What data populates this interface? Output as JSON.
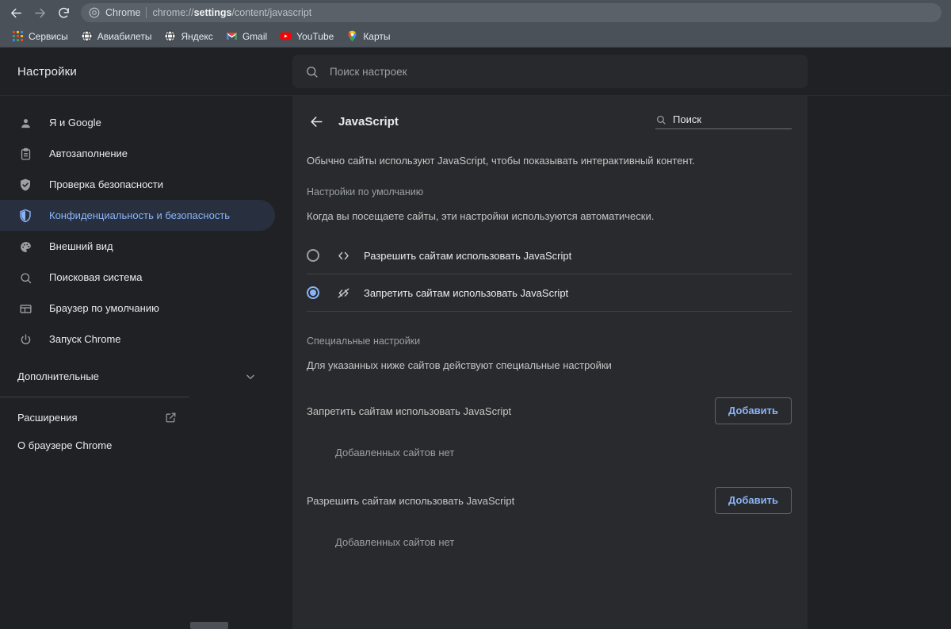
{
  "browser": {
    "nav": {
      "back_icon": "arrow-left-icon",
      "forward_icon": "arrow-right-icon",
      "reload_icon": "reload-icon"
    },
    "omnibox": {
      "site_icon": "chrome-logo-icon",
      "chip_label": "Chrome",
      "url_prefix": "chrome://",
      "url_bold": "settings",
      "url_suffix": "/content/javascript"
    },
    "bookmarks": [
      {
        "label": "Сервисы",
        "icon": "google-apps-grid-icon"
      },
      {
        "label": "Авиабилеты",
        "icon": "globe-icon"
      },
      {
        "label": "Яндекс",
        "icon": "globe-icon"
      },
      {
        "label": "Gmail",
        "icon": "gmail-icon"
      },
      {
        "label": "YouTube",
        "icon": "youtube-icon"
      },
      {
        "label": "Карты",
        "icon": "google-maps-pin-icon"
      }
    ]
  },
  "settings": {
    "brand_title": "Настройки",
    "search": {
      "icon": "search-icon",
      "placeholder": "Поиск настроек",
      "value": ""
    },
    "sidebar": {
      "items": [
        {
          "label": "Я и Google",
          "icon": "person-icon",
          "active": false
        },
        {
          "label": "Автозаполнение",
          "icon": "clipboard-icon",
          "active": false
        },
        {
          "label": "Проверка безопасности",
          "icon": "shield-check-icon",
          "active": false
        },
        {
          "label": "Конфиденциальность и безопасность",
          "icon": "shield-half-icon",
          "active": true
        },
        {
          "label": "Внешний вид",
          "icon": "palette-icon",
          "active": false
        },
        {
          "label": "Поисковая система",
          "icon": "search-icon",
          "active": false
        },
        {
          "label": "Браузер по умолчанию",
          "icon": "browser-window-icon",
          "active": false
        },
        {
          "label": "Запуск Chrome",
          "icon": "power-icon",
          "active": false
        }
      ],
      "advanced_label": "Дополнительные",
      "advanced_caret_icon": "chevron-down-icon",
      "extensions_label": "Расширения",
      "extensions_icon": "external-link-icon",
      "about_label": "О браузере Chrome"
    }
  },
  "page": {
    "back_icon": "arrow-left-icon",
    "title": "JavaScript",
    "inline_search": {
      "icon": "search-icon",
      "label": "Поиск",
      "value": "Поиск"
    },
    "description": "Обычно сайты используют JavaScript, чтобы показывать интерактивный контент.",
    "default_section": {
      "label": "Настройки по умолчанию",
      "subtitle": "Когда вы посещаете сайты, эти настройки используются автоматически.",
      "options": [
        {
          "label": "Разрешить сайтам использовать JavaScript",
          "icon": "code-brackets-icon",
          "selected": false
        },
        {
          "label": "Запретить сайтам использовать JavaScript",
          "icon": "code-brackets-slash-icon",
          "selected": true
        }
      ]
    },
    "custom_section": {
      "label": "Специальные настройки",
      "subtitle": "Для указанных ниже сайтов действуют специальные настройки",
      "groups": [
        {
          "label": "Запретить сайтам использовать JavaScript",
          "add_label": "Добавить",
          "empty_label": "Добавленных сайтов нет"
        },
        {
          "label": "Разрешить сайтам использовать JavaScript",
          "add_label": "Добавить",
          "empty_label": "Добавленных сайтов нет"
        }
      ]
    }
  },
  "colors": {
    "accent_blue": "#8ab4f8",
    "toolbar_bg": "#4a5159",
    "page_bg": "#202124",
    "card_bg": "#292a2d",
    "active_item_bg": "#28303f"
  }
}
